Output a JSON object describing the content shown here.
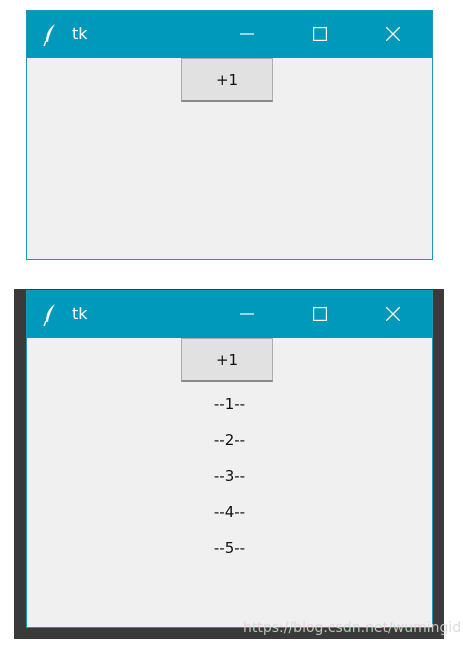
{
  "window_top": {
    "title": "tk",
    "button_label": "+1"
  },
  "window_bottom": {
    "title": "tk",
    "button_label": "+1",
    "labels": [
      "--1--",
      "--2--",
      "--3--",
      "--4--",
      "--5--"
    ]
  },
  "watermark": "https://blog.csdn.net/wumingid",
  "colors": {
    "titlebar": "#0099bc",
    "client": "#f0f0f0",
    "button": "#e1e1e1"
  }
}
